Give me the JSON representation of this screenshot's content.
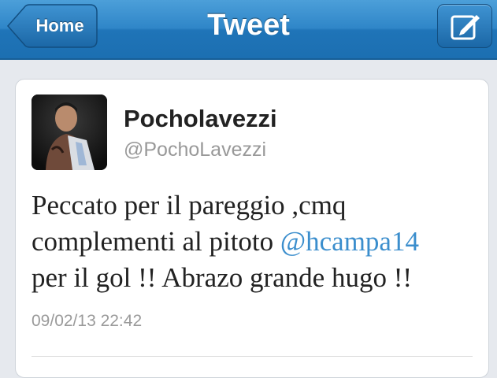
{
  "navbar": {
    "title": "Tweet",
    "back_label": "Home",
    "compose_icon": "compose-icon"
  },
  "tweet": {
    "display_name": "Pocholavezzi",
    "handle": "@PochoLavezzi",
    "text_line1": "Peccato per il pareggio ,cmq",
    "text_line2_prefix": "complementi al pitoto ",
    "mention": "@hcampa14",
    "text_line3": "per il gol !! Abrazo grande hugo !!",
    "timestamp": "09/02/13 22:42"
  },
  "colors": {
    "navbar": "#2f86c8",
    "mention": "#3b8ecd",
    "background": "#e6e9ee"
  }
}
